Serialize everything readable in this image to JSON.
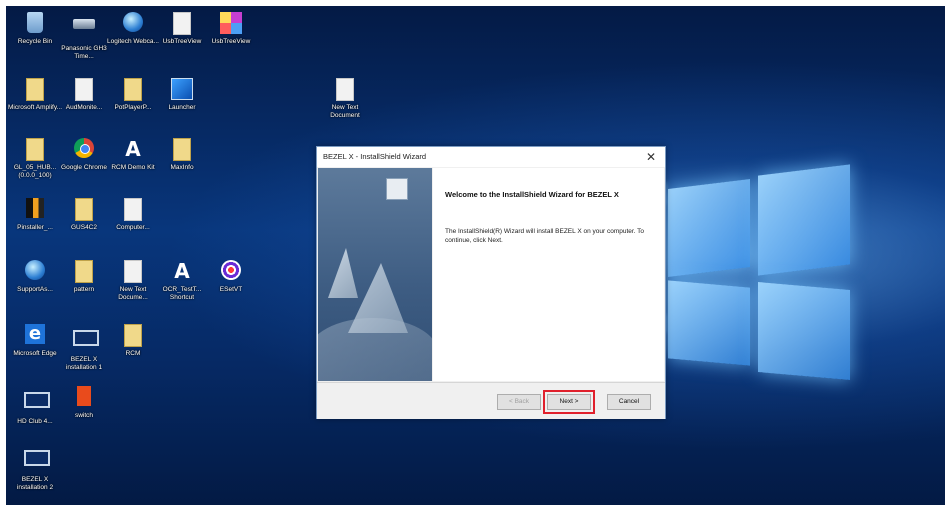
{
  "desktop": {
    "icons": [
      {
        "label": "Recycle Bin"
      },
      {
        "label": "Panasonic GH3 Time..."
      },
      {
        "label": "Logitech Webca..."
      },
      {
        "label": "UsbTreeView"
      },
      {
        "label": "UsbTreeView"
      },
      {
        "label": "Microsoft Amplify..."
      },
      {
        "label": "AudMonite..."
      },
      {
        "label": "PotPlayerP..."
      },
      {
        "label": "Launcher"
      },
      {
        "label": "New Text Document"
      },
      {
        "label": "GL_05_HUB... (0.0.0_100)"
      },
      {
        "label": "Google Chrome"
      },
      {
        "label": "RCM Demo Kit"
      },
      {
        "label": "MaxInfo"
      },
      {
        "label": "Pinstaller_..."
      },
      {
        "label": "GUS4C2"
      },
      {
        "label": "Computer..."
      },
      {
        "label": "SupportAs..."
      },
      {
        "label": "pattern"
      },
      {
        "label": "New Text Docume..."
      },
      {
        "label": "OCR_TestT... Shortcut"
      },
      {
        "label": "ESetVT"
      },
      {
        "label": "Microsoft Edge"
      },
      {
        "label": "BEZEL X installation 1"
      },
      {
        "label": "RCM"
      },
      {
        "label": "HD Club 4..."
      },
      {
        "label": "switch"
      },
      {
        "label": "BEZEL X installation 2"
      }
    ]
  },
  "dialog": {
    "title": "BEZEL X - InstallShield Wizard",
    "close_glyph": "✕",
    "welcome": "Welcome to the InstallShield Wizard for BEZEL X",
    "description": "The InstallShield(R) Wizard will install BEZEL X on your computer. To continue, click Next.",
    "buttons": {
      "back": "< Back",
      "next": "Next >",
      "cancel": "Cancel"
    },
    "highlight_color": "#e0202c"
  },
  "icons": {
    "close": "close-icon",
    "installer": "installer-icon"
  }
}
